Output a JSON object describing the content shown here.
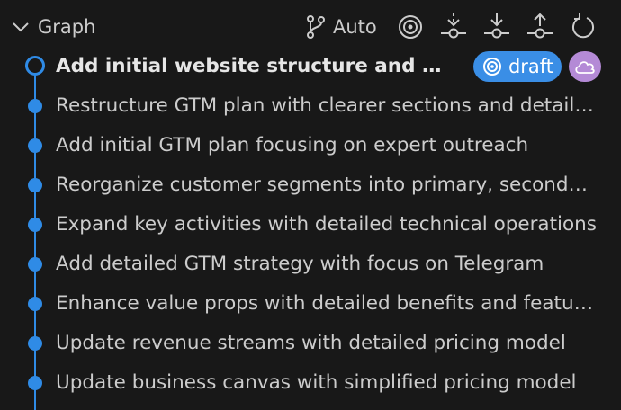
{
  "header": {
    "title": "Graph",
    "auto_label": "Auto",
    "collapse_icon": "chevron-down-icon",
    "toolbar_icons": [
      "target-icon",
      "fetch-icon",
      "pull-icon",
      "push-icon",
      "refresh-icon"
    ]
  },
  "graph": {
    "head": {
      "label": "Add initial website structure and components",
      "badge_label": "draft",
      "badge_icon": "target-icon",
      "remote_icon": "cloud-icon"
    },
    "commits": [
      {
        "label": "Restructure GTM plan with clearer sections and detailed strategy"
      },
      {
        "label": "Add initial GTM plan focusing on expert outreach"
      },
      {
        "label": "Reorganize customer segments into primary, secondary"
      },
      {
        "label": "Expand key activities with detailed technical operations"
      },
      {
        "label": "Add detailed GTM strategy with focus on Telegram"
      },
      {
        "label": "Enhance value props with detailed benefits and features"
      },
      {
        "label": "Update revenue streams with detailed pricing model"
      },
      {
        "label": "Update business canvas with simplified pricing model"
      }
    ]
  },
  "colors": {
    "background": "#181818",
    "graph_line": "#2f8be6",
    "draft_badge": "#3a8ee6",
    "cloud_badge": "#b48ad6",
    "text": "#cccccc"
  }
}
